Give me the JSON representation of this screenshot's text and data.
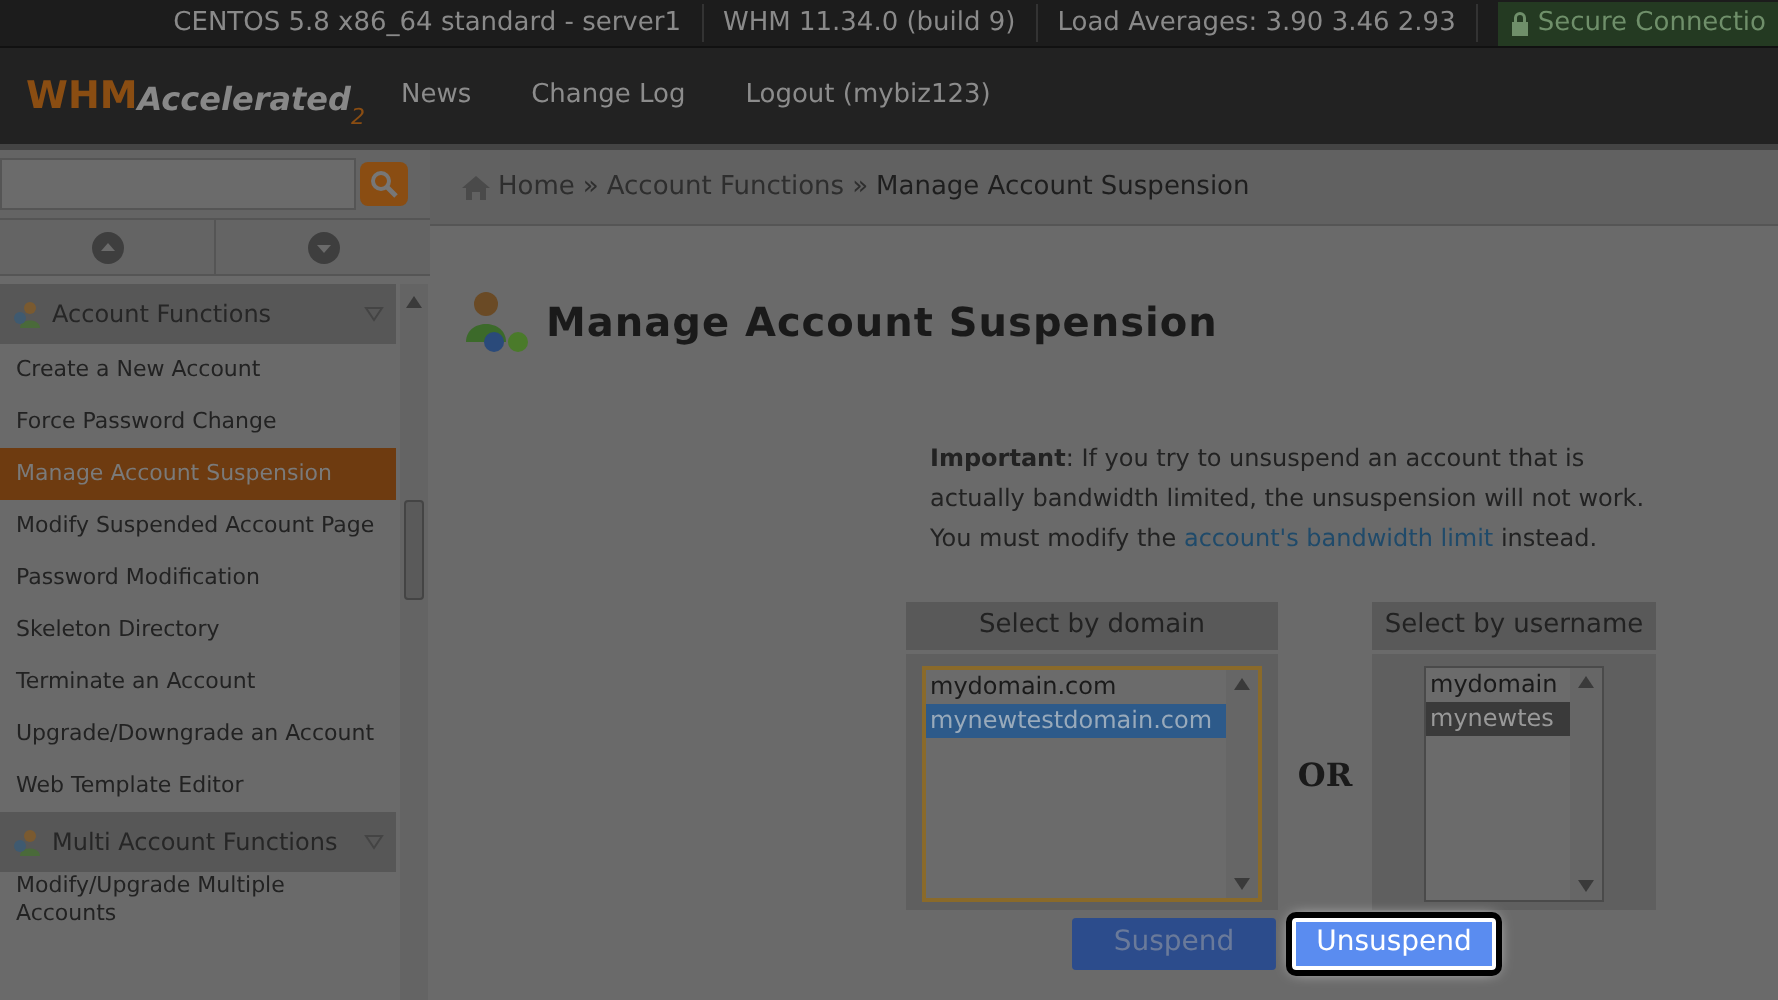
{
  "status_bar": {
    "items": [
      "CENTOS 5.8 x86_64 standard - server1",
      "WHM 11.34.0 (build 9)",
      "Load Averages: 3.90 3.46 2.93"
    ],
    "secure": "Secure Connectio"
  },
  "header": {
    "logo": "WHM",
    "logo_sub": "Accelerated",
    "logo_ver": "2",
    "nav": [
      "News",
      "Change Log",
      "Logout (mybiz123)"
    ]
  },
  "sidebar": {
    "groups": [
      {
        "title": "Account Functions",
        "items": [
          {
            "label": "Create a New Account",
            "selected": false
          },
          {
            "label": "Force Password Change",
            "selected": false
          },
          {
            "label": "Manage Account Suspension",
            "selected": true
          },
          {
            "label": "Modify Suspended Account Page",
            "selected": false
          },
          {
            "label": "Password Modification",
            "selected": false
          },
          {
            "label": "Skeleton Directory",
            "selected": false
          },
          {
            "label": "Terminate an Account",
            "selected": false
          },
          {
            "label": "Upgrade/Downgrade an Account",
            "selected": false
          },
          {
            "label": "Web Template Editor",
            "selected": false
          }
        ]
      },
      {
        "title": "Multi Account Functions",
        "items": [
          {
            "label": "Modify/Upgrade Multiple Accounts",
            "selected": false
          }
        ]
      }
    ]
  },
  "breadcrumb": {
    "separator": "»",
    "items": [
      "Home",
      "Account Functions",
      "Manage Account Suspension"
    ]
  },
  "title": "Manage Account Suspension",
  "notice": {
    "lead": "Important",
    "text": ": If you try to unsuspend an account that is actually bandwidth limited, the unsuspension will not work. You must modify the ",
    "link": "account's bandwidth limit",
    "tail": " instead."
  },
  "domain_select": {
    "header": "Select by domain",
    "options": [
      {
        "label": "mydomain.com",
        "selected": false
      },
      {
        "label": "mynewtestdomain.com",
        "selected": true
      }
    ]
  },
  "separator": "OR",
  "user_select": {
    "header": "Select by username",
    "options": [
      {
        "label": "mydomain",
        "selected": false
      },
      {
        "label": "mynewtes",
        "selected": true
      }
    ]
  },
  "buttons": [
    {
      "label": "Suspend",
      "focused": false
    },
    {
      "label": "Unsuspend",
      "focused": true
    }
  ]
}
